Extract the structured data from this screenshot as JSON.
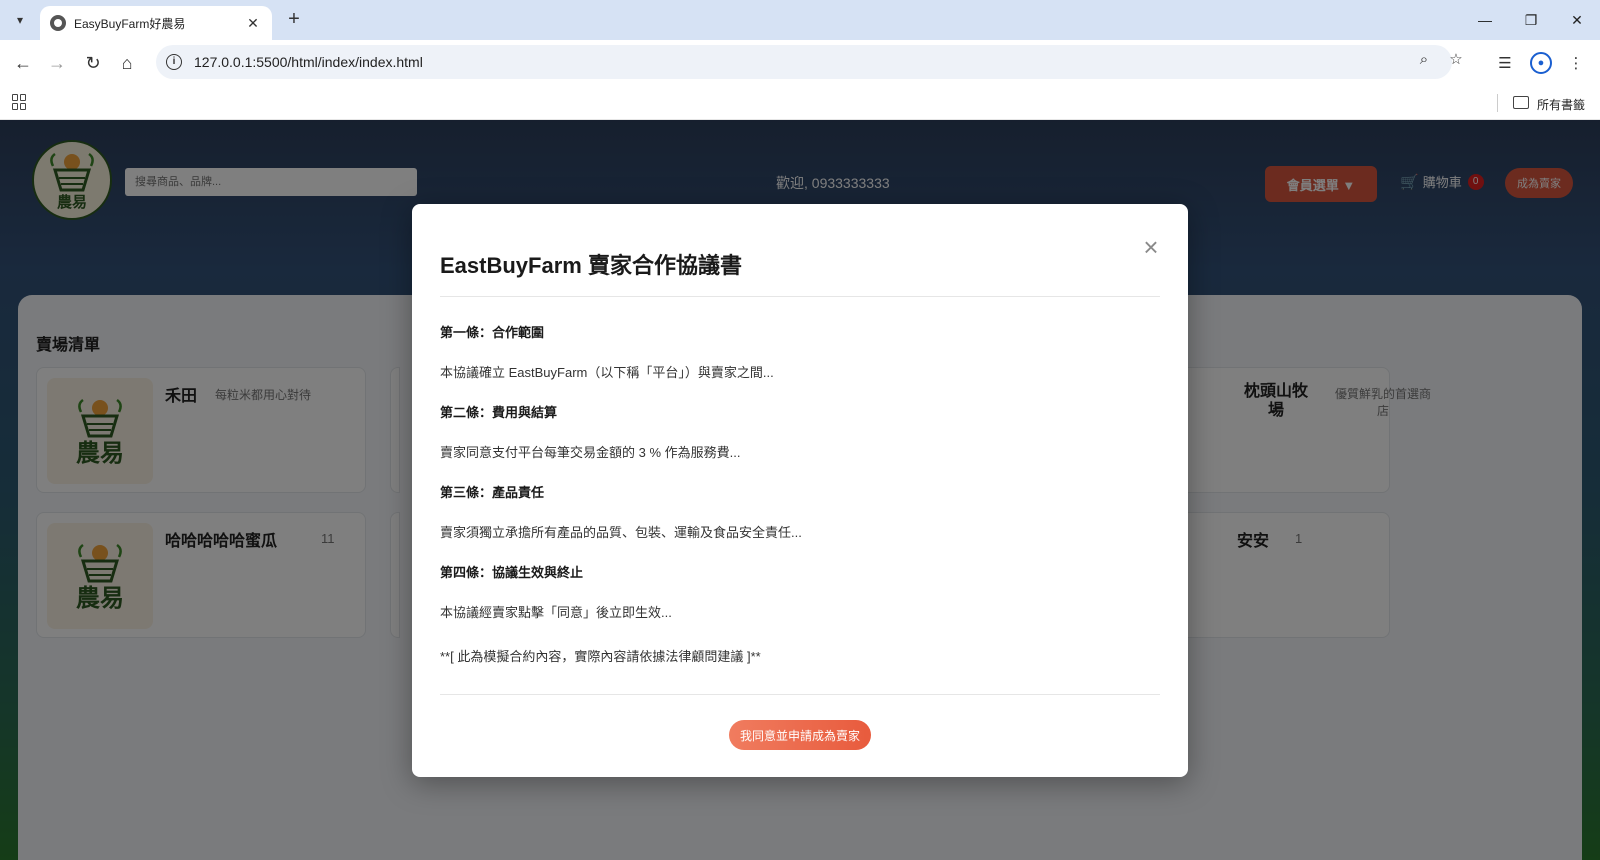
{
  "browser": {
    "tab_title": "EasyBuyFarm好農易",
    "url": "127.0.0.1:5500/html/index/index.html",
    "bookmarks_label": "所有書籤"
  },
  "header": {
    "logo_text": "農易",
    "search_placeholder": "搜尋商品、品牌...",
    "welcome": "歡迎, 0933333333",
    "member_menu_label": "會員選單 ▼",
    "cart_label": "購物車",
    "cart_count": "0",
    "become_seller_label": "成為賣家"
  },
  "stores": {
    "section_title": "賣場清單",
    "items": [
      {
        "name": "禾田",
        "desc": "每粒米都用心對待"
      },
      {
        "name": "枕頭山牧場",
        "desc": "優質鮮乳的首選商店"
      },
      {
        "name": "哈哈哈哈哈蜜瓜",
        "desc": "11"
      },
      {
        "name": "安安",
        "desc": "1"
      }
    ]
  },
  "modal": {
    "title": "EastBuyFarm 賣家合作協議書",
    "close": "×",
    "clauses": [
      {
        "heading": "第一條：合作範圍",
        "text": "本協議確立 EastBuyFarm（以下稱「平台」）與賣家之間..."
      },
      {
        "heading": "第二條：費用與結算",
        "text": "賣家同意支付平台每筆交易金額的 3 % 作為服務費..."
      },
      {
        "heading": "第三條：產品責任",
        "text": "賣家須獨立承擔所有產品的品質、包裝、運輸及食品安全責任..."
      },
      {
        "heading": "第四條：協議生效與終止",
        "text": "本協議經賣家點擊「同意」後立即生效..."
      }
    ],
    "disclaimer": "**[ 此為模擬合約內容，實際內容請依據法律顧問建議 ]**",
    "agree_button": "我同意並申請成為賣家"
  }
}
